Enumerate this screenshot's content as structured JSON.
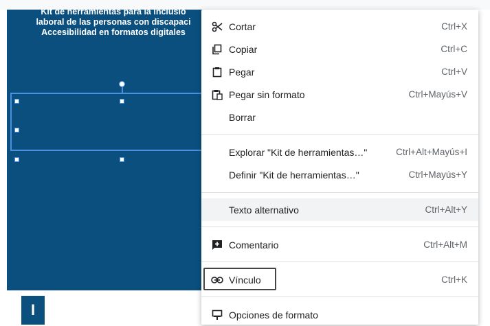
{
  "slide": {
    "textbox_text": "Kit de herramientas para la inclusió\nlaboral de las personas con discapaci\nAccesibilidad en formatos digitales",
    "cursor_label": "I"
  },
  "context_menu": {
    "items": [
      {
        "label": "Cortar",
        "shortcut": "Ctrl+X",
        "icon": "scissors-icon"
      },
      {
        "label": "Copiar",
        "shortcut": "Ctrl+C",
        "icon": "copy-icon"
      },
      {
        "label": "Pegar",
        "shortcut": "Ctrl+V",
        "icon": "clipboard-icon"
      },
      {
        "label": "Pegar sin formato",
        "shortcut": "Ctrl+Mayús+V",
        "icon": "clipboard-plain-icon"
      },
      {
        "label": "Borrar",
        "shortcut": "",
        "icon": ""
      },
      {
        "label": "Explorar \"Kit de herramientas…\"",
        "shortcut": "Ctrl+Alt+Mayús+I",
        "icon": ""
      },
      {
        "label": "Definir \"Kit de herramientas…\"",
        "shortcut": "Ctrl+Mayús+Y",
        "icon": ""
      },
      {
        "label": "Texto alternativo",
        "shortcut": "Ctrl+Alt+Y",
        "icon": ""
      },
      {
        "label": "Comentario",
        "shortcut": "Ctrl+Alt+M",
        "icon": "add-comment-icon"
      },
      {
        "label": "Vínculo",
        "shortcut": "Ctrl+K",
        "icon": "link-icon"
      },
      {
        "label": "Opciones de formato",
        "shortcut": "",
        "icon": "format-options-icon"
      }
    ],
    "highlighted": "Texto alternativo",
    "focused": "Vínculo"
  },
  "colors": {
    "slide_background": "#0b4f7e",
    "selection": "#4a90e2",
    "highlight_row": "#f1f3f4"
  }
}
